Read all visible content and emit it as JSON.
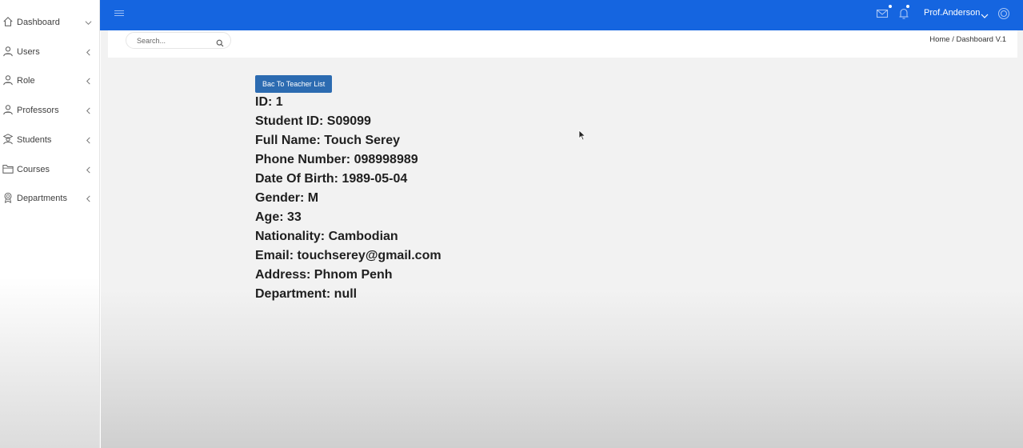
{
  "sidebar": {
    "items": [
      {
        "label": "Dashboard",
        "icon": "home-icon",
        "chevron": "chevron-down-icon"
      },
      {
        "label": "Users",
        "icon": "user-icon",
        "chevron": "chevron-left-icon"
      },
      {
        "label": "Role",
        "icon": "user-icon",
        "chevron": "chevron-left-icon"
      },
      {
        "label": "Professors",
        "icon": "user-icon",
        "chevron": "chevron-left-icon"
      },
      {
        "label": "Students",
        "icon": "student-icon",
        "chevron": "chevron-left-icon"
      },
      {
        "label": "Courses",
        "icon": "folder-icon",
        "chevron": "chevron-left-icon"
      },
      {
        "label": "Departments",
        "icon": "badge-icon",
        "chevron": "chevron-left-icon"
      }
    ]
  },
  "topbar": {
    "user_name": "Prof.Anderson",
    "color": "#1565e0",
    "icons": [
      "menu-icon",
      "mail-icon",
      "bell-icon",
      "chevron-down-icon",
      "settings-circle-icon"
    ]
  },
  "search": {
    "placeholder": "Search..."
  },
  "breadcrumb": {
    "home": "Home",
    "separator": " / ",
    "current": "Dashboard V.1"
  },
  "back_button": {
    "label": "Bac To Teacher List"
  },
  "details": [
    "ID: 1",
    "Student ID: S09099",
    "Full Name: Touch Serey",
    "Phone Number: 098998989",
    "Date Of Birth: 1989-05-04",
    "Gender: M",
    "Age: 33",
    "Nationality: Cambodian",
    "Email: touchserey@gmail.com",
    "Address: Phnom Penh",
    "Department: null"
  ]
}
